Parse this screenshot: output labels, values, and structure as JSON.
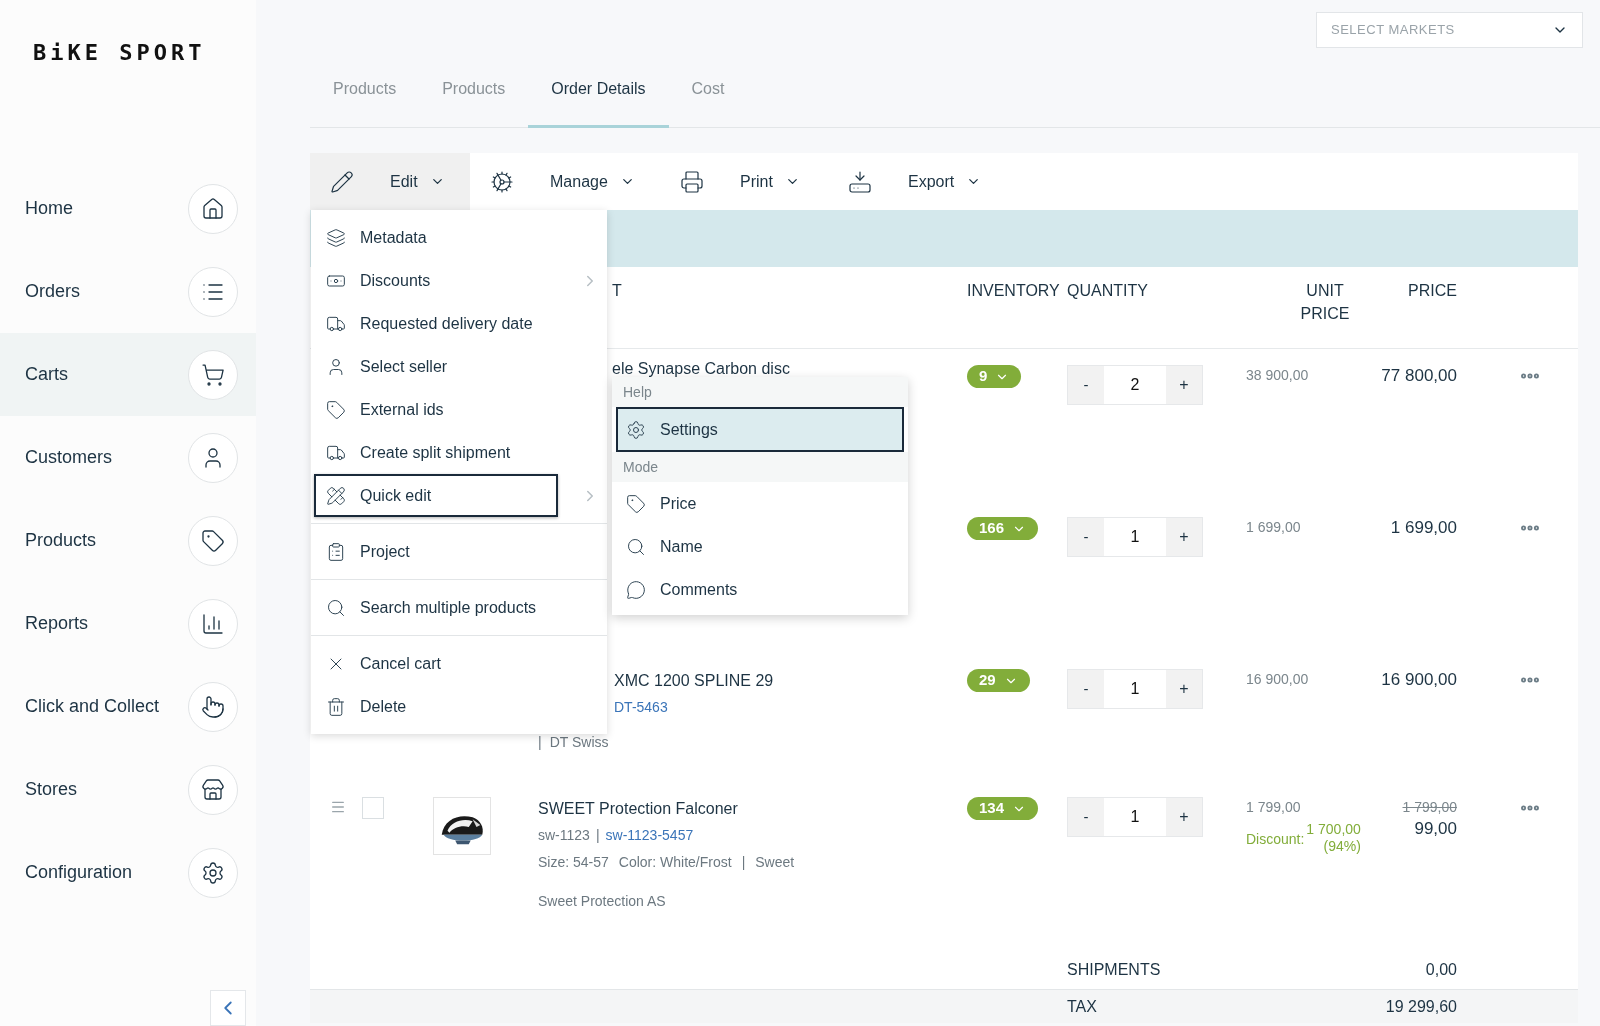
{
  "logo": "BiKE SPORT",
  "sidebar": {
    "items": [
      {
        "label": "Home",
        "selected": false
      },
      {
        "label": "Orders",
        "selected": false
      },
      {
        "label": "Carts",
        "selected": true
      },
      {
        "label": "Customers",
        "selected": false
      },
      {
        "label": "Products",
        "selected": false
      },
      {
        "label": "Reports",
        "selected": false
      },
      {
        "label": "Click and Collect",
        "selected": false
      },
      {
        "label": "Stores",
        "selected": false
      },
      {
        "label": "Configuration",
        "selected": false
      }
    ]
  },
  "market_select": {
    "placeholder": "SELECT MARKETS"
  },
  "tabs": [
    {
      "label": "Products",
      "selected": false
    },
    {
      "label": "Products",
      "selected": false
    },
    {
      "label": "Order Details",
      "selected": true
    },
    {
      "label": "Cost",
      "selected": false
    }
  ],
  "toolbar": [
    {
      "label": "Edit",
      "open": true
    },
    {
      "label": "Manage",
      "open": false
    },
    {
      "label": "Print",
      "open": false
    },
    {
      "label": "Export",
      "open": false
    }
  ],
  "table": {
    "columns": [
      "T",
      "INVENTORY",
      "QUANTITY",
      "UNIT PRICE",
      "PRICE"
    ],
    "rows": [
      {
        "name": "ele Synapse Carbon disc",
        "inventory": "9",
        "quantity": "2",
        "unit_price": "38 900,00",
        "price": "77 800,00"
      },
      {
        "inventory": "166",
        "quantity": "1",
        "unit_price": "1 699,00",
        "price": "1 699,00"
      },
      {
        "name": "XMC 1200 SPLINE 29",
        "sku_link": "DT-5463",
        "separator": "|",
        "brand": "DT Swiss",
        "inventory": "29",
        "quantity": "1",
        "unit_price": "16 900,00",
        "price": "16 900,00"
      },
      {
        "has_image": true,
        "checked": false,
        "name": "SWEET Protection Falconer",
        "sku": "sw-1123",
        "separator": "|",
        "sku_link": "sw-1123-5457",
        "size": "Size: 54-57",
        "color_text": "Color: White/Frost",
        "brand": "Sweet",
        "supplier": "Sweet Protection AS",
        "inventory": "134",
        "quantity": "1",
        "unit_price": "1 799,00",
        "discount_label": "Discount:",
        "discount_amount": "1 700,00",
        "discount_percent": "(94%)",
        "original_price": "1 799,00",
        "price": "99,00"
      }
    ],
    "minus": "-",
    "plus": "+"
  },
  "totals": [
    {
      "label": "SHIPMENTS",
      "value": "0,00"
    },
    {
      "label": "TAX",
      "value": "19 299,60"
    }
  ],
  "edit_menu": {
    "groups": [
      [
        {
          "label": "Metadata",
          "submenu": false,
          "selected": false
        },
        {
          "label": "Discounts",
          "submenu": true,
          "selected": false
        },
        {
          "label": "Requested delivery date",
          "submenu": false,
          "selected": false
        },
        {
          "label": "Select seller",
          "submenu": false,
          "selected": false
        },
        {
          "label": "External ids",
          "submenu": false,
          "selected": false
        },
        {
          "label": "Create split shipment",
          "submenu": false,
          "selected": false
        },
        {
          "label": "Quick edit",
          "submenu": true,
          "selected": true
        }
      ],
      [
        {
          "label": "Project",
          "submenu": false,
          "selected": false
        }
      ],
      [
        {
          "label": "Search multiple products",
          "submenu": false,
          "selected": false
        }
      ],
      [
        {
          "label": "Cancel cart",
          "submenu": false,
          "selected": false
        },
        {
          "label": "Delete",
          "submenu": false,
          "selected": false
        }
      ]
    ]
  },
  "quick_edit_menu": {
    "sections": [
      {
        "title": "Help",
        "items": [
          {
            "label": "Settings",
            "selected": true
          }
        ]
      },
      {
        "title": "Mode",
        "items": [
          {
            "label": "Price",
            "selected": false
          },
          {
            "label": "Name",
            "selected": false
          },
          {
            "label": "Comments",
            "selected": false
          }
        ]
      }
    ]
  }
}
